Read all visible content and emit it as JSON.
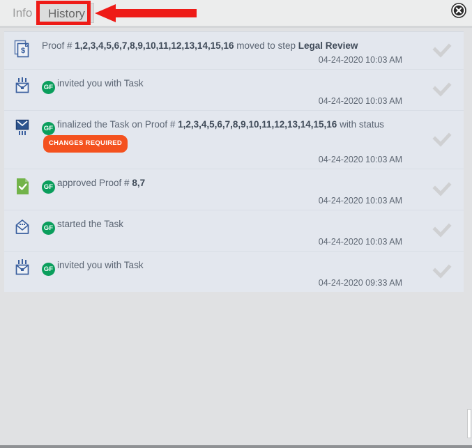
{
  "window": {
    "close_icon": "close-circle-icon"
  },
  "tabs": [
    {
      "label": "Info",
      "active": false
    },
    {
      "label": "History",
      "active": true
    }
  ],
  "annotation": {
    "type": "red-box-and-arrow",
    "color": "#ee1b17",
    "target": "History"
  },
  "history": {
    "rows": [
      {
        "icon": "proof-document-icon",
        "avatar": null,
        "segments": [
          {
            "text": "Proof # ",
            "bold": false
          },
          {
            "text": "1,2,3,4,5,6,7,8,9,10,11,12,13,14,15,16",
            "bold": true
          },
          {
            "text": " moved to step ",
            "bold": false
          },
          {
            "text": "Legal Review",
            "bold": true
          }
        ],
        "badge": null,
        "timestamp": "04-24-2020 10:03 AM",
        "check_icon": "check-icon"
      },
      {
        "icon": "invite-envelope-icon",
        "avatar": "GF",
        "segments": [
          {
            "text": "invited you with Task",
            "bold": false
          }
        ],
        "badge": null,
        "timestamp": "04-24-2020 10:03 AM",
        "check_icon": "check-icon"
      },
      {
        "icon": "sent-envelope-icon",
        "avatar": "GF",
        "segments": [
          {
            "text": "finalized the Task on Proof # ",
            "bold": false
          },
          {
            "text": "1,2,3,4,5,6,7,8,9,10,11,12,13,14,15,16",
            "bold": true
          },
          {
            "text": " with status ",
            "bold": false
          }
        ],
        "badge": "CHANGES REQUIRED",
        "badge_color": "#f4511e",
        "timestamp": "04-24-2020 10:03 AM",
        "check_icon": "check-icon"
      },
      {
        "icon": "approved-document-icon",
        "avatar": "GF",
        "segments": [
          {
            "text": "approved Proof # ",
            "bold": false
          },
          {
            "text": "8,7",
            "bold": true
          }
        ],
        "badge": null,
        "timestamp": "04-24-2020 10:03 AM",
        "check_icon": "check-icon"
      },
      {
        "icon": "open-envelope-icon",
        "avatar": "GF",
        "segments": [
          {
            "text": "started the Task",
            "bold": false
          }
        ],
        "badge": null,
        "timestamp": "04-24-2020 10:03 AM",
        "check_icon": "check-icon"
      },
      {
        "icon": "invite-envelope-icon",
        "avatar": "GF",
        "segments": [
          {
            "text": "invited you with Task",
            "bold": false
          }
        ],
        "badge": null,
        "timestamp": "04-24-2020 09:33 AM",
        "check_icon": "check-icon"
      }
    ]
  },
  "colors": {
    "avatar_green": "#0a9e5c",
    "badge_orange": "#f4511e",
    "icon_blue": "#3a5f9e",
    "approved_green": "#72b34a",
    "panel_bg": "#e3e7ee",
    "page_bg": "#e0e1e3"
  }
}
